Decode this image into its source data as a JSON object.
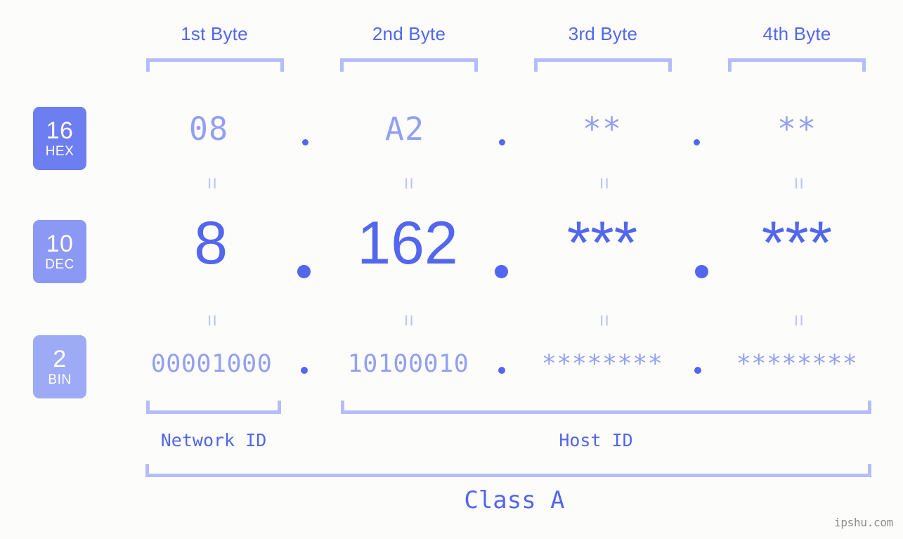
{
  "meta": {
    "watermark": "ipshu.com"
  },
  "colors": {
    "background": "#fcfdfa",
    "accent_strong": "#5266ef",
    "accent_mid": "#93a0f2",
    "accent_light": "#b4bdfa",
    "equals": "#bcc4f7",
    "badge_hex": "#6d7ef0",
    "badge_dec": "#8b98f4",
    "badge_bin": "#9dabf7",
    "watermark": "#8d8d8d"
  },
  "byte_headers": [
    {
      "label": "1st Byte"
    },
    {
      "label": "2nd Byte"
    },
    {
      "label": "3rd Byte"
    },
    {
      "label": "4th Byte"
    }
  ],
  "radix_badges": [
    {
      "number": "16",
      "abbr": "HEX"
    },
    {
      "number": "10",
      "abbr": "DEC"
    },
    {
      "number": "2",
      "abbr": "BIN"
    }
  ],
  "rows": {
    "hex": {
      "radix_number": "16",
      "radix_abbr": "HEX",
      "values": [
        "08",
        "A2",
        "**",
        "**"
      ],
      "separator": "."
    },
    "dec": {
      "radix_number": "10",
      "radix_abbr": "DEC",
      "values": [
        "8",
        "162",
        "***",
        "***"
      ],
      "separator": "."
    },
    "bin": {
      "radix_number": "2",
      "radix_abbr": "BIN",
      "values": [
        "00001000",
        "10100010",
        "********",
        "********"
      ],
      "separator": "."
    }
  },
  "equals_symbol": "=",
  "segments": [
    {
      "label": "Network ID"
    },
    {
      "label": "Host ID"
    }
  ],
  "class_label": "Class A"
}
